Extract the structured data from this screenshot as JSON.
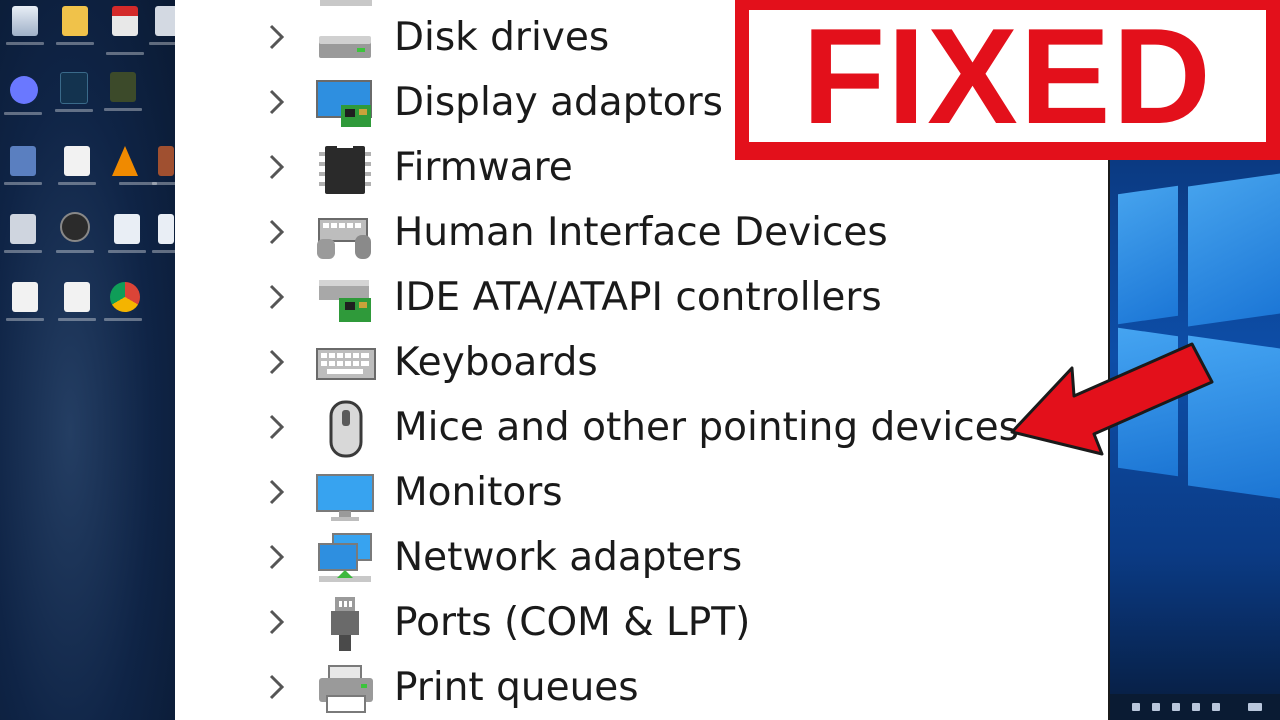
{
  "banner": {
    "text": "FIXED",
    "color": "#e3101b"
  },
  "device_tree": {
    "items": [
      {
        "label": "Disk drives",
        "icon": "disk-drive-icon"
      },
      {
        "label": "Display adaptors",
        "icon": "display-adapter-icon"
      },
      {
        "label": "Firmware",
        "icon": "firmware-chip-icon"
      },
      {
        "label": "Human Interface Devices",
        "icon": "hid-icon"
      },
      {
        "label": "IDE ATA/ATAPI controllers",
        "icon": "ide-controller-icon"
      },
      {
        "label": "Keyboards",
        "icon": "keyboard-icon"
      },
      {
        "label": "Mice and other pointing devices",
        "icon": "mouse-icon"
      },
      {
        "label": "Monitors",
        "icon": "monitor-icon"
      },
      {
        "label": "Network adapters",
        "icon": "network-adapter-icon"
      },
      {
        "label": "Ports (COM & LPT)",
        "icon": "port-icon"
      },
      {
        "label": "Print queues",
        "icon": "printer-icon"
      }
    ],
    "highlighted": "Mice and other pointing devices"
  },
  "colors": {
    "accent_red": "#e3101b",
    "panel_bg": "#ffffff",
    "desktop_bg": "#0f2446"
  }
}
